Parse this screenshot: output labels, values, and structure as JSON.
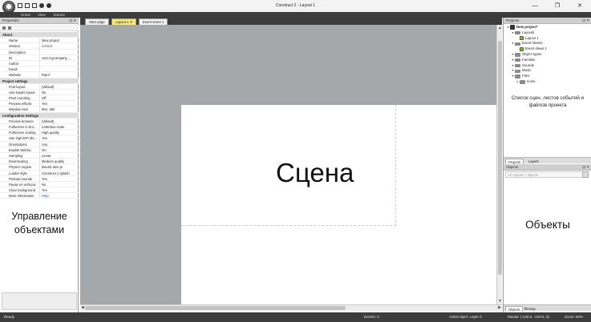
{
  "window": {
    "title": "Construct 2 - Layout 1",
    "controls": [
      "—",
      "❐",
      "✕"
    ]
  },
  "quick_access": [
    "save-icon",
    "undo-icon",
    "redo-icon",
    "preview-icon",
    "settings-icon"
  ],
  "menu": {
    "items": [
      "Home",
      "View",
      "Events"
    ]
  },
  "properties_panel": {
    "title": "Properties",
    "rows": [
      {
        "type": "section",
        "name": "About"
      },
      {
        "name": "Name",
        "value": "New project"
      },
      {
        "name": "Version",
        "value": "1.0.0.0"
      },
      {
        "name": "Description",
        "value": ""
      },
      {
        "name": "ID",
        "value": "com.mycompany...."
      },
      {
        "name": "Author",
        "value": ""
      },
      {
        "name": "Email",
        "value": ""
      },
      {
        "name": "Website",
        "value": "http://"
      },
      {
        "type": "section",
        "name": "Project settings"
      },
      {
        "name": "First layout",
        "value": "(default)"
      },
      {
        "name": "Use loader layout",
        "value": "No"
      },
      {
        "name": "Pixel rounding",
        "value": "Off"
      },
      {
        "name": "Preview effects",
        "value": "Yes"
      },
      {
        "name": "Window Size",
        "value": "854, 480"
      },
      {
        "type": "section",
        "name": "Configuration Settings"
      },
      {
        "name": "Preview browser",
        "value": "(default)"
      },
      {
        "name": "Fullscreen in bro...",
        "value": "Letterbox scale"
      },
      {
        "name": "Fullscreen scaling",
        "value": "High quality"
      },
      {
        "name": "Use high-DPI dis...",
        "value": "Yes"
      },
      {
        "name": "Orientations",
        "value": "Any"
      },
      {
        "name": "Enable WebGL",
        "value": "On"
      },
      {
        "name": "Sampling",
        "value": "Linear"
      },
      {
        "name": "Downscaling",
        "value": "Medium quality"
      },
      {
        "name": "Physics engine",
        "value": "Box2D asm.js"
      },
      {
        "name": "Loader style",
        "value": "Construct 2 splash"
      },
      {
        "name": "Preload sounds",
        "value": "Yes"
      },
      {
        "name": "Pause on unfocus",
        "value": "No"
      },
      {
        "name": "Clear background",
        "value": "Yes"
      },
      {
        "name": "More information",
        "value": "Help",
        "link": true
      }
    ],
    "annotation": "Управление объектами"
  },
  "document_tabs": [
    {
      "label": "Start page",
      "active": false
    },
    {
      "label": "Layout 1",
      "active": true
    },
    {
      "label": "Event sheet 1",
      "active": false
    }
  ],
  "layout_view": {
    "scene_label": "Сцена"
  },
  "projects_panel": {
    "title": "Projects",
    "tree": [
      {
        "label": "New project*",
        "level": 0,
        "icon": "root",
        "bold": true
      },
      {
        "label": "Layouts",
        "level": 1,
        "icon": "folder"
      },
      {
        "label": "Layout 1",
        "level": 2,
        "icon": "leaf"
      },
      {
        "label": "Event sheets",
        "level": 1,
        "icon": "folder"
      },
      {
        "label": "Event sheet 1",
        "level": 2,
        "icon": "leaf"
      },
      {
        "label": "Object types",
        "level": 1,
        "icon": "folder"
      },
      {
        "label": "Families",
        "level": 1,
        "icon": "folder"
      },
      {
        "label": "Sounds",
        "level": 1,
        "icon": "folder"
      },
      {
        "label": "Music",
        "level": 1,
        "icon": "folder"
      },
      {
        "label": "Files",
        "level": 1,
        "icon": "folder"
      },
      {
        "label": "Icons",
        "level": 2,
        "icon": "folder"
      }
    ],
    "annotation": "Список сцен, листов событий и файлов проекта",
    "tabs": [
      "Projects",
      "Layers"
    ]
  },
  "objects_panel": {
    "title": "Objects",
    "filter_placeholder": "All 'Layout 1' objects",
    "annotation": "Объекты",
    "tabs": [
      "Objects",
      "Tilemap"
    ]
  },
  "statusbar": {
    "status": "Ready",
    "events": "Events: 0",
    "active_layer": "Active layer: Layer 0",
    "mouse": "Mouse: (-240.0, -219.5, 0)",
    "zoom": "Zoom: 60%"
  }
}
